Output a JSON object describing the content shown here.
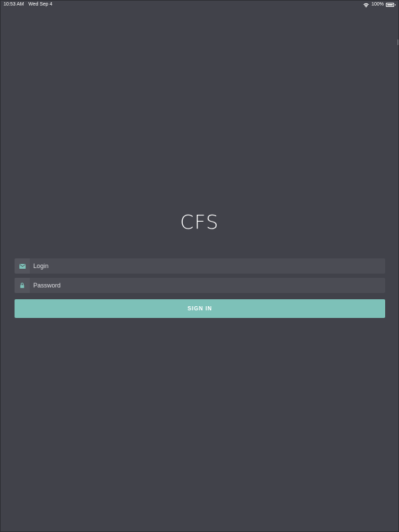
{
  "status_bar": {
    "time": "10:53 AM",
    "date": "Wed Sep 4",
    "battery": "100%",
    "wifi_icon": "wifi-icon",
    "battery_icon": "battery-full-icon"
  },
  "app": {
    "title": "CFS"
  },
  "login_form": {
    "login": {
      "placeholder": "Login",
      "value": "",
      "icon": "envelope-icon"
    },
    "password": {
      "placeholder": "Password",
      "value": "",
      "icon": "lock-icon"
    },
    "submit_label": "SIGN IN"
  },
  "colors": {
    "background": "#41424a",
    "field_background": "#4b4c54",
    "accent": "#7dc1b8",
    "icon_color": "#7dc1b8",
    "text": "#ffffff"
  }
}
